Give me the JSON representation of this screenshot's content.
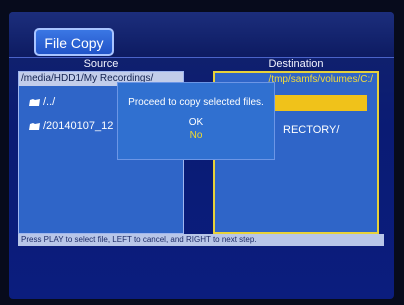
{
  "window": {
    "title": "File Copy"
  },
  "source": {
    "label": "Source",
    "path": "/media/HDD1/My Recordings/",
    "items": [
      "/../",
      "/20140107_12"
    ]
  },
  "destination": {
    "label": "Destination",
    "path": "/tmp/samfs/volumes/C:/",
    "directory_text": "RECTORY/"
  },
  "dialog": {
    "message": "Proceed to copy selected files.",
    "ok_label": "OK",
    "no_label": "No",
    "selected": "No"
  },
  "status": {
    "hint": "Press PLAY to select file, LEFT to cancel, and RIGHT to next step."
  },
  "colors": {
    "highlight": "#f0c21a",
    "selected_text": "#f5dc2a",
    "panel": "#2f65c8",
    "dialog": "#3070d0"
  },
  "icons": {
    "folder": "folder-icon"
  }
}
